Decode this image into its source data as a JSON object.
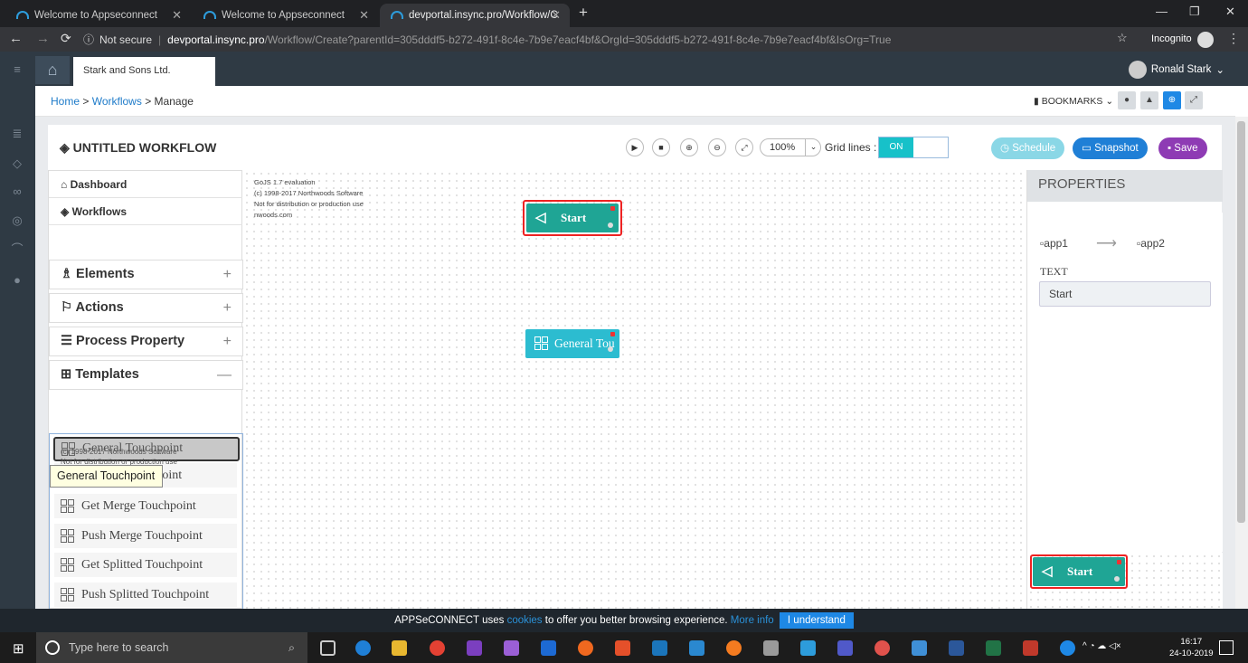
{
  "browser": {
    "tabs": [
      {
        "title": "Welcome to Appseconnect"
      },
      {
        "title": "Welcome to Appseconnect"
      },
      {
        "title": "devportal.insync.pro/Workflow/C"
      }
    ],
    "not_secure": "Not secure",
    "url_domain": "devportal.insync.pro",
    "url_path": "/Workflow/Create?parentId=305dddf5-b272-491f-8c4e-7b9e7eacf4bf&OrgId=305dddf5-b272-491f-8c4e-7b9e7eacf4bf&IsOrg=True",
    "incognito": "Incognito"
  },
  "app": {
    "org_tab": "Stark and Sons Ltd.",
    "user_name": "Ronald Stark",
    "breadcrumb": {
      "home": "Home",
      "sep": ">",
      "workflows": "Workflows",
      "current": "Manage"
    },
    "bookmarks": "BOOKMARKS"
  },
  "workflow": {
    "title": "UNTITLED WORKFLOW",
    "zoom": "100%",
    "grid_label": "Grid lines :",
    "grid_state": "ON",
    "schedule": "Schedule",
    "snapshot": "Snapshot",
    "save": "Save"
  },
  "sidebar": {
    "dashboard": "Dashboard",
    "workflows": "Workflows",
    "elements": "Elements",
    "actions": "Actions",
    "process_property": "Process Property",
    "templates": "Templates",
    "template_items": [
      "General Touchpoint",
      "Get Merge Touchpoint",
      "Push Merge Touchpoint",
      "Get Splitted Touchpoint",
      "Push Splitted Touchpoint"
    ],
    "drag_ghost_label": "General Touchpoint",
    "drag_ghost_note1": "GoJS 1.7 evaluation",
    "drag_ghost_note2": "(c) 1998-2017 Northwoods Software",
    "drag_ghost_note3": "Not for distribution or production use",
    "tooltip": "General Touchpoint"
  },
  "canvas": {
    "watermark": [
      "GoJS 1.7 evaluation",
      "(c) 1998-2017 Northwoods Software",
      "Not for distribution or production use",
      "nwoods.com"
    ],
    "start_node": "Start",
    "general_node": "General Tou"
  },
  "properties": {
    "title": "PROPERTIES",
    "app1": "app1",
    "app2": "app2",
    "text_label": "TEXT",
    "text_value": "Start",
    "overview_node": "Start"
  },
  "cookie": {
    "pre": "APPSeCONNECT uses",
    "link": "cookies",
    "mid": "to offer you better browsing experience.",
    "more": "More info",
    "button": "I understand"
  },
  "taskbar": {
    "search_placeholder": "Type here to search",
    "time": "16:17",
    "date": "24-10-2019"
  }
}
